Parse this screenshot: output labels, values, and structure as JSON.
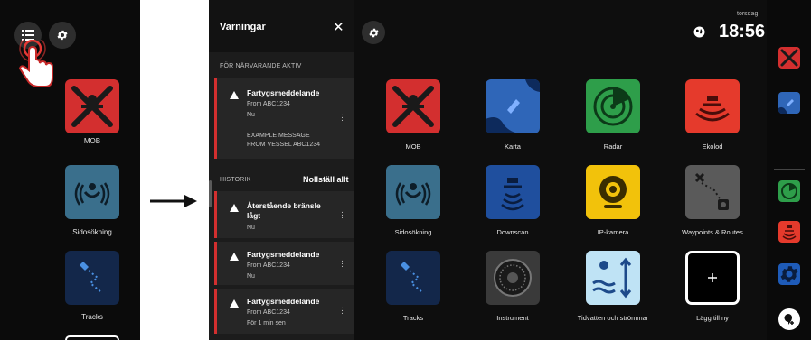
{
  "left_screen": {
    "apps": [
      {
        "label": "MOB",
        "color": "#d32f2f",
        "icon": "mob-icon"
      },
      {
        "label": "Sidosökning",
        "color": "#3a6f8c",
        "icon": "sidescan-icon"
      },
      {
        "label": "Tracks",
        "color": "#13274a",
        "icon": "tracks-icon"
      }
    ],
    "buttons": {
      "alerts": "list-icon",
      "settings": "gear-icon"
    }
  },
  "alerts": {
    "title": "Varningar",
    "close_icon": "close-icon",
    "current_active_label": "FÖR NÄRVARANDE AKTIV",
    "history_label": "HISTORIK",
    "reset_all_label": "Nollställ allt",
    "active": [
      {
        "title": "Fartygsmeddelande",
        "source": "From ABC1234",
        "time": "Nu",
        "message_line1": "EXAMPLE MESSAGE",
        "message_line2": "FROM VESSEL ABC1234"
      }
    ],
    "history": [
      {
        "title_line1": "Återstående bränsle",
        "title_line2": "lågt",
        "time": "Nu"
      },
      {
        "title": "Fartygsmeddelande",
        "source": "From ABC1234",
        "time": "Nu"
      },
      {
        "title": "Fartygsmeddelande",
        "source": "From ABC1234",
        "time": "För 1 min sen"
      }
    ],
    "accent_color": "#d32f2f"
  },
  "status": {
    "day": "torsdag",
    "time": "18:56"
  },
  "home_apps": [
    {
      "label": "MOB",
      "color": "#d32f2f",
      "icon": "mob-icon"
    },
    {
      "label": "Karta",
      "color": "#2f66b8",
      "icon": "chart-icon"
    },
    {
      "label": "Radar",
      "color": "#2e9e4a",
      "icon": "radar-icon"
    },
    {
      "label": "Ekolod",
      "color": "#e53a2c",
      "icon": "echo-icon"
    },
    {
      "label": "Sidosökning",
      "color": "#3a6f8c",
      "icon": "sidescan-icon"
    },
    {
      "label": "Downscan",
      "color": "#1f4f9e",
      "icon": "downscan-icon"
    },
    {
      "label": "IP-kamera",
      "color": "#f2c20b",
      "icon": "camera-icon"
    },
    {
      "label": "Waypoints & Routes",
      "color": "#5a5a5a",
      "icon": "waypoints-icon"
    },
    {
      "label": "Tracks",
      "color": "#13274a",
      "icon": "tracks-icon"
    },
    {
      "label": "Instrument",
      "color": "#3a3a3a",
      "icon": "instrument-icon"
    },
    {
      "label": "Tidvatten och strömmar",
      "color": "#bfe3f5",
      "icon": "tides-icon"
    },
    {
      "label": "Lägg till ny",
      "color": "#000000",
      "icon": "plus-icon"
    }
  ],
  "sidebar_apps": [
    "mob-icon",
    "chart-icon",
    "radar-icon",
    "echo-icon",
    "gear-icon",
    "add-app-icon"
  ]
}
